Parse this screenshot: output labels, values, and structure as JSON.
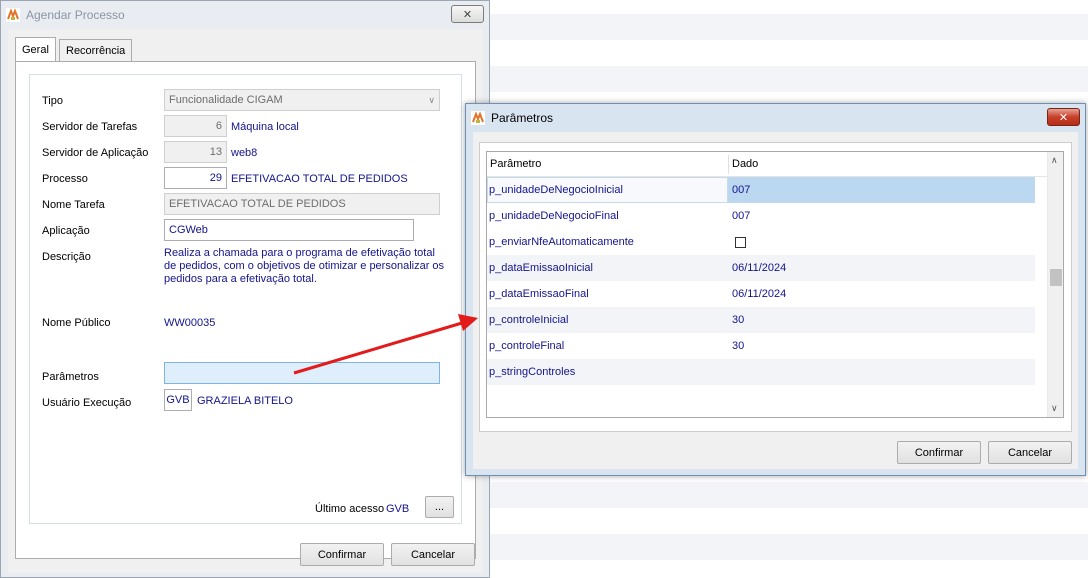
{
  "agendar": {
    "title": "Agendar Processo",
    "close_label": "✕",
    "tabs": [
      {
        "label": "Geral"
      },
      {
        "label": "Recorrência"
      }
    ],
    "form": {
      "tipo": {
        "label": "Tipo",
        "value": "Funcionalidade CIGAM"
      },
      "servidor_tarefas": {
        "label": "Servidor de Tarefas",
        "number": "6",
        "name": "Máquina local"
      },
      "servidor_aplicacao": {
        "label": "Servidor de Aplicação",
        "number": "13",
        "name": "web8"
      },
      "processo": {
        "label": "Processo",
        "number": "29",
        "name": "EFETIVACAO TOTAL DE PEDIDOS"
      },
      "nome_tarefa": {
        "label": "Nome Tarefa",
        "value": "EFETIVACAO TOTAL DE PEDIDOS"
      },
      "aplicacao": {
        "label": "Aplicação",
        "value": "CGWeb"
      },
      "descricao": {
        "label": "Descrição",
        "lines": [
          "Realiza a chamada para o programa de efetivação total",
          "de pedidos, com o objetivos de otimizar e personalizar os",
          "pedidos para a efetivação total."
        ]
      },
      "nome_publico": {
        "label": "Nome Público",
        "value": "WW00035"
      },
      "parametros": {
        "label": "Parâmetros",
        "value": ""
      },
      "usuario_execucao": {
        "label": "Usuário Execução",
        "code": "GVB",
        "name": "GRAZIELA BITELO"
      },
      "ultimo_acesso": {
        "label": "Último acesso",
        "value": "GVB",
        "button": "..."
      }
    },
    "buttons": {
      "confirm": "Confirmar",
      "cancel": "Cancelar"
    }
  },
  "parametros": {
    "title": "Parâmetros",
    "close_label": "✕",
    "columns": [
      "Parâmetro",
      "Dado"
    ],
    "rows": [
      {
        "name": "p_unidadeDeNegocioInicial",
        "value": "007"
      },
      {
        "name": "p_unidadeDeNegocioFinal",
        "value": "007"
      },
      {
        "name": "p_enviarNfeAutomaticamente",
        "value": "",
        "checkbox": true,
        "checked": false
      },
      {
        "name": "p_dataEmissaoInicial",
        "value": "06/11/2024"
      },
      {
        "name": "p_dataEmissaoFinal",
        "value": "06/11/2024"
      },
      {
        "name": "p_controleInicial",
        "value": "30"
      },
      {
        "name": "p_controleFinal",
        "value": "30"
      },
      {
        "name": "p_stringControles",
        "value": ""
      }
    ],
    "buttons": {
      "confirm": "Confirmar",
      "cancel": "Cancelar"
    }
  },
  "colors": {
    "accent_text": "#14148c",
    "selected_row": "#bcd7f0",
    "arrow": "#e31b1b"
  },
  "icons": [
    "app-icon",
    "close-icon",
    "chevron-down-icon",
    "scroll-up-icon",
    "scroll-down-icon",
    "annotation-arrow"
  ]
}
